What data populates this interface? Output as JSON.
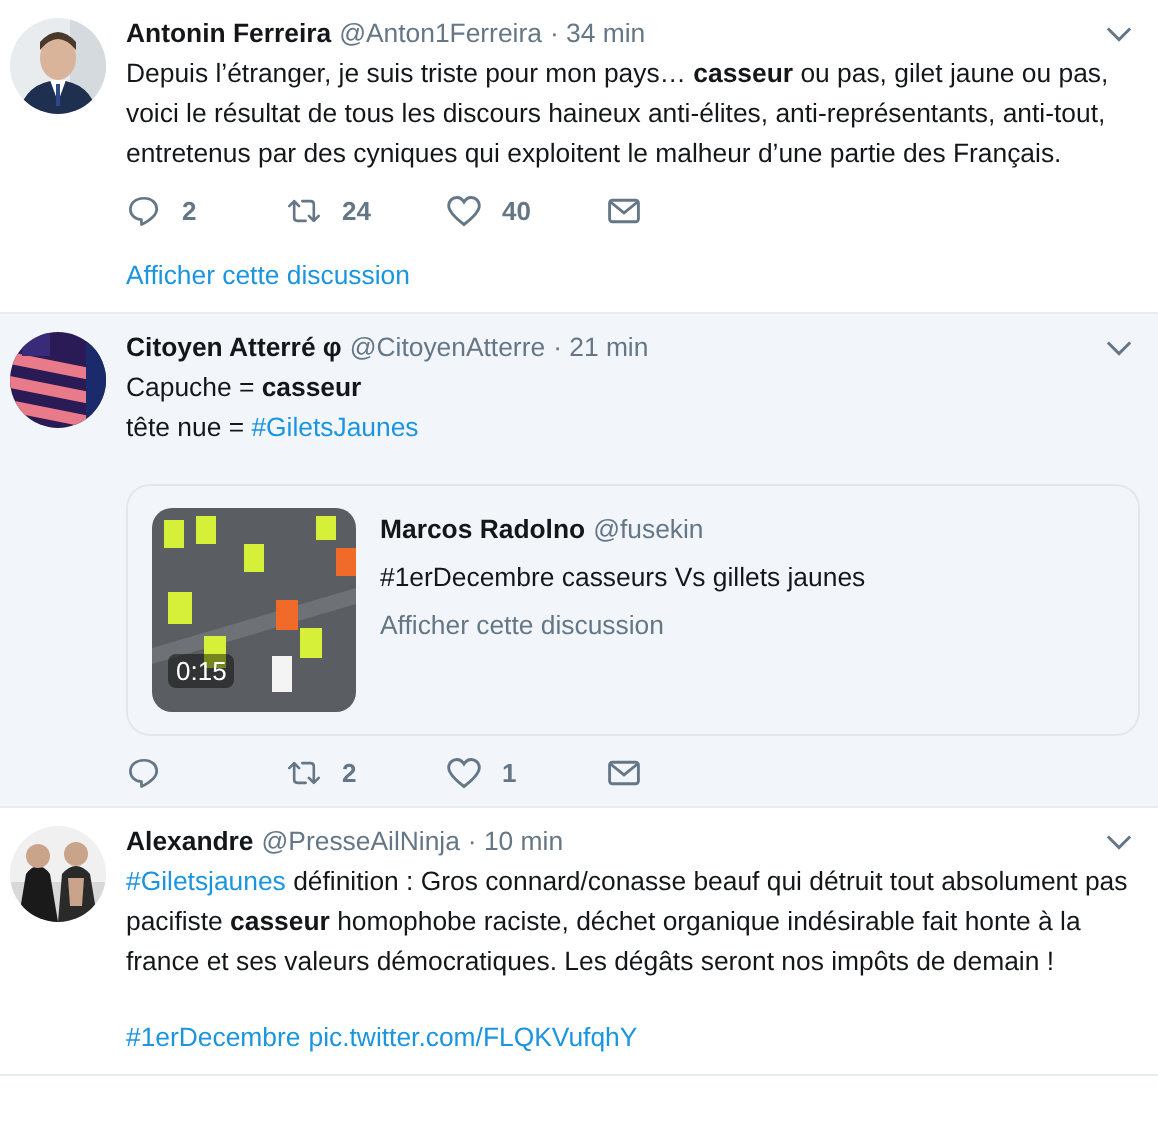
{
  "tweets": [
    {
      "name": "Antonin Ferreira",
      "handle": "@Anton1Ferreira",
      "time": "· 34 min",
      "highlighted": false,
      "paragraphs": [
        [
          {
            "kind": "plain",
            "text": "Depuis l’étranger, je suis triste pour mon pays… "
          },
          {
            "kind": "bold",
            "text": "casseur"
          },
          {
            "kind": "plain",
            "text": " ou pas, gilet jaune ou pas, voici le résultat de tous les discours haineux anti-élites, anti-représentants, anti-tout, entretenus par des cyniques qui exploitent le malheur d’une partie des Français."
          }
        ]
      ],
      "actions": {
        "replies": "2",
        "retweets": "24",
        "likes": "40"
      },
      "thread_link": "Afficher cette discussion"
    },
    {
      "name": "Citoyen Atterré φ",
      "handle": "@CitoyenAtterre",
      "time": "· 21 min",
      "highlighted": true,
      "paragraphs": [
        [
          {
            "kind": "plain",
            "text": "Capuche = "
          },
          {
            "kind": "bold",
            "text": "casseur"
          }
        ],
        [
          {
            "kind": "plain",
            "text": "tête nue = "
          },
          {
            "kind": "link",
            "text": "#GiletsJaunes"
          }
        ]
      ],
      "quote": {
        "name": "Marcos Radolno",
        "handle": "@fusekin",
        "text": "#1erDecembre casseurs Vs gillets jaunes",
        "duration": "0:15",
        "thread_link": "Afficher cette discussion"
      },
      "actions": {
        "retweets": "2",
        "likes": "1"
      }
    },
    {
      "name": "Alexandre",
      "handle": "@PresseAilNinja",
      "time": "· 10 min",
      "highlighted": false,
      "paragraphs": [
        [
          {
            "kind": "link",
            "text": "#Giletsjaunes"
          },
          {
            "kind": "plain",
            "text": " définition : Gros connard/conasse beauf qui détruit tout absolument pas pacifiste "
          },
          {
            "kind": "bold",
            "text": "casseur"
          },
          {
            "kind": "plain",
            "text": " homophobe raciste, déchet organique indésirable fait honte à la france et ses valeurs démocratiques. Les dégâts seront nos impôts de demain !"
          }
        ],
        [
          {
            "kind": "link",
            "text": "#1erDecembre"
          },
          {
            "kind": "link",
            "text": "pic.twitter.com/FLQKVufqhY"
          }
        ]
      ]
    }
  ]
}
